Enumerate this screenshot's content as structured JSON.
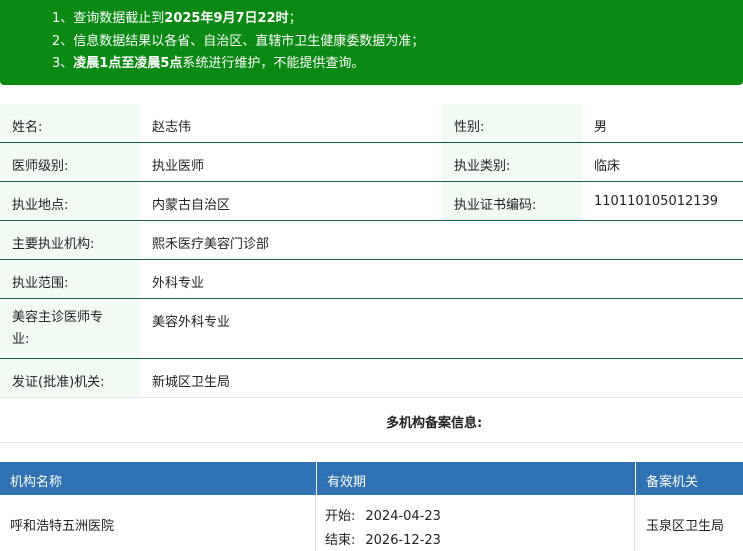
{
  "notice": {
    "line1_prefix": "1、查询数据截止到",
    "line1_bold": "2025年9月7日22时",
    "line1_suffix": "；",
    "line2": "2、信息数据结果以各省、自治区、直辖市卫生健康委数据为准；",
    "line3_prefix": "3、",
    "line3_bold": "凌晨1点至凌晨5点",
    "line3_suffix": "系统进行维护，不能提供查询。"
  },
  "info": {
    "name_label": "姓名:",
    "name": "赵志伟",
    "gender_label": "性别:",
    "gender": "男",
    "level_label": "医师级别:",
    "level": "执业医师",
    "category_label": "执业类别:",
    "category": "临床",
    "location_label": "执业地点:",
    "location": "内蒙古自治区",
    "cert_label": "执业证书编码:",
    "cert": "110110105012139",
    "org_label": "主要执业机构:",
    "org": "熙禾医疗美容门诊部",
    "scope_label": "执业范围:",
    "scope": "外科专业",
    "beauty_label_1": "美容主诊医师专",
    "beauty_label_2": "业:",
    "beauty": "美容外科专业",
    "issuer_label": "发证(批准)机关:",
    "issuer": "新城区卫生局"
  },
  "multi": {
    "title": "多机构备案信息:",
    "headers": [
      "机构名称",
      "有效期",
      "备案机关"
    ],
    "rows": [
      {
        "org": "呼和浩特五洲医院",
        "start_label": "开始:",
        "start": "2024-04-23",
        "end_label": "结束:",
        "end": "2026-12-23",
        "authority": "玉泉区卫生局"
      }
    ]
  }
}
